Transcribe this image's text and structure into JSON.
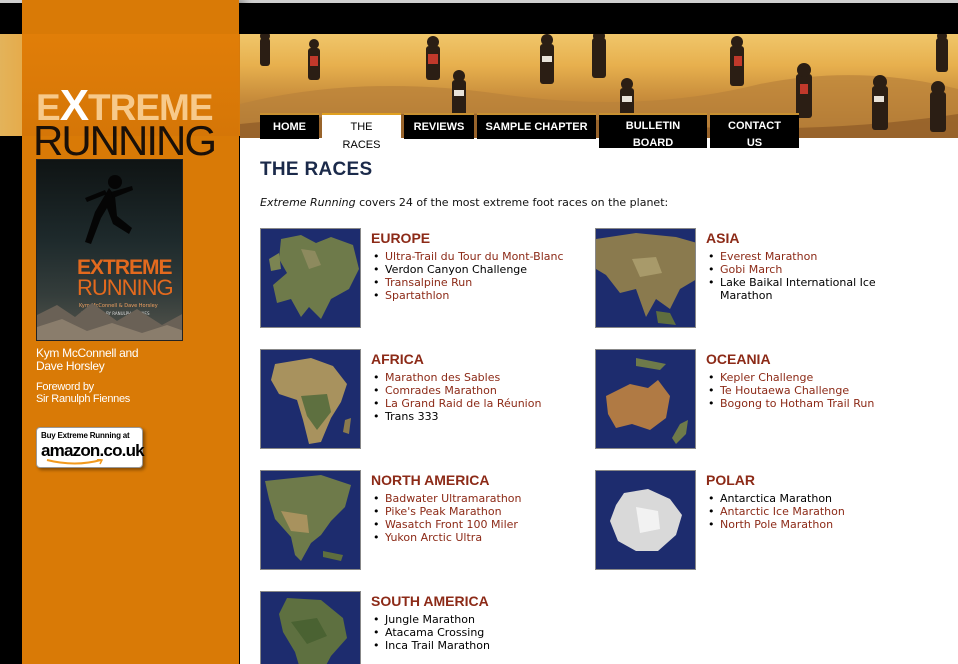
{
  "logo": {
    "extreme_prefix": "E",
    "extreme_x": "X",
    "extreme_rest": "TREME",
    "running": "RUNNING"
  },
  "book": {
    "title_top": "EXTREME",
    "title_bottom": "RUNNING",
    "authors": "Kym McConnell & Dave Horsley",
    "foreword": "FOREWORD BY RANULPH FIENNES"
  },
  "sidebar": {
    "author_line1": "Kym McConnell and",
    "author_line2": "Dave Horsley",
    "foreword_line1": "Foreword by",
    "foreword_line2": "Sir Ranulph Fiennes",
    "amazon_buy": "Buy Extreme Running at",
    "amazon_brand": "amazon.co.uk"
  },
  "nav": [
    {
      "line1": "HOME",
      "line2": ""
    },
    {
      "line1": "THE",
      "line2": "RACES"
    },
    {
      "line1": "REVIEWS",
      "line2": ""
    },
    {
      "line1": "SAMPLE CHAPTER",
      "line2": ""
    },
    {
      "line1": "BULLETIN",
      "line2": "BOARD"
    },
    {
      "line1": "CONTACT",
      "line2": "US"
    }
  ],
  "page": {
    "title": "THE RACES",
    "intro_em": "Extreme Running",
    "intro_rest": " covers 24 of the most extreme foot races on the planet:"
  },
  "regions": {
    "europe": {
      "title": "EUROPE",
      "races": [
        "Ultra-Trail du Tour du Mont-Blanc",
        "Verdon Canyon Challenge",
        "Transalpine Run",
        "Spartathlon"
      ]
    },
    "asia": {
      "title": "ASIA",
      "races": [
        "Everest Marathon",
        "Gobi March",
        "Lake Baikal International Ice Marathon"
      ]
    },
    "africa": {
      "title": "AFRICA",
      "races": [
        "Marathon des Sables",
        "Comrades Marathon",
        "La Grand Raid de la Réunion",
        "Trans 333"
      ]
    },
    "oceania": {
      "title": "OCEANIA",
      "races": [
        "Kepler Challenge",
        "Te Houtaewa Challenge",
        "Bogong to Hotham Trail Run"
      ]
    },
    "north_america": {
      "title": "NORTH AMERICA",
      "races": [
        "Badwater Ultramarathon",
        "Pike's Peak Marathon",
        "Wasatch Front 100 Miler",
        "Yukon Arctic Ultra"
      ]
    },
    "polar": {
      "title": "POLAR",
      "races": [
        "Antarctica Marathon",
        "Antarctic Ice Marathon",
        "North Pole Marathon"
      ]
    },
    "south_america": {
      "title": "SOUTH AMERICA",
      "races": [
        "Jungle Marathon",
        "Atacama Crossing",
        "Inca Trail Marathon"
      ]
    }
  }
}
